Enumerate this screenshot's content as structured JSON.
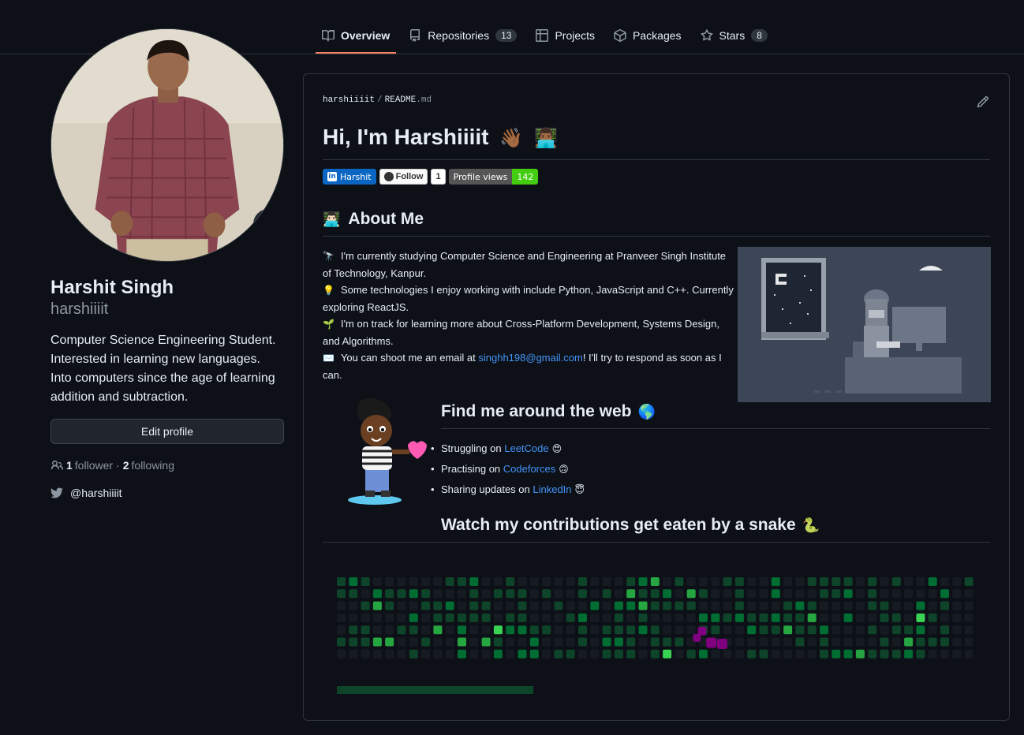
{
  "nav": {
    "tabs": [
      {
        "label": "Overview",
        "icon": "book-icon",
        "active": true
      },
      {
        "label": "Repositories",
        "icon": "repo-icon",
        "count": "13"
      },
      {
        "label": "Projects",
        "icon": "table-icon"
      },
      {
        "label": "Packages",
        "icon": "package-icon"
      },
      {
        "label": "Stars",
        "icon": "star-icon",
        "count": "8"
      }
    ]
  },
  "profile": {
    "status_emoji": "🏠",
    "name": "Harshit Singh",
    "login": "harshiiiit",
    "bio": "Computer Science Engineering Student. Interested in learning new languages. Into computers since the age of learning addition and subtraction.",
    "edit_label": "Edit profile",
    "followers_count": "1",
    "followers_label": "follower",
    "separator": "·",
    "following_count": "2",
    "following_label": "following",
    "twitter": "@harshiiiit"
  },
  "readme": {
    "owner": "harshiiiit",
    "sep": "/",
    "file_base": "README",
    "file_ext": ".md",
    "title": "Hi, I'm Harshiiiit",
    "title_emojis": [
      "👋🏾",
      "👨🏾‍💻"
    ],
    "badges": {
      "linkedin_label": "Harshit",
      "follow_label": "Follow",
      "follow_count": "1",
      "views_label": "Profile views",
      "views_count": "142"
    },
    "about": {
      "heading": "About Me",
      "heading_emoji": "👨🏻‍💻",
      "lines": [
        {
          "emoji": "🔭",
          "text": "I'm currently studying Computer Science and Engineering at Pranveer Singh Institute of Technology, Kanpur."
        },
        {
          "emoji": "💡",
          "text": "Some technologies I enjoy working with include Python, JavaScript and C++. Currently exploring ReactJS."
        },
        {
          "emoji": "🌱",
          "text": "I'm on track for learning more about Cross-Platform Development, Systems Design, and Algorithms."
        },
        {
          "emoji": "✉️",
          "text_before": "You can shoot me an email at ",
          "email": "singhh198@gmail.com",
          "text_after": "! I'll try to respond as soon as I can."
        }
      ]
    },
    "web": {
      "heading": "Find me around the web",
      "heading_emoji": "🌎",
      "items": [
        {
          "prefix": "Struggling on ",
          "link": "LeetCode",
          "emoji": "😍"
        },
        {
          "prefix": "Practising on ",
          "link": "Codeforces",
          "emoji": "🙃"
        },
        {
          "prefix": "Sharing updates on ",
          "link": "LinkedIn",
          "emoji": "😇"
        }
      ]
    },
    "snake": {
      "heading": "Watch my contributions get eaten by a snake",
      "heading_emoji": "🐍"
    }
  },
  "colors": {
    "bg": "#0d1117",
    "border": "#30363d",
    "accent": "#f78166",
    "link": "#4493f8",
    "grid_empty": "#161b22",
    "grid_l1": "#0e4429",
    "grid_l2": "#006d32",
    "grid_l3": "#26a641",
    "grid_l4": "#39d353",
    "snake": "#800080"
  }
}
